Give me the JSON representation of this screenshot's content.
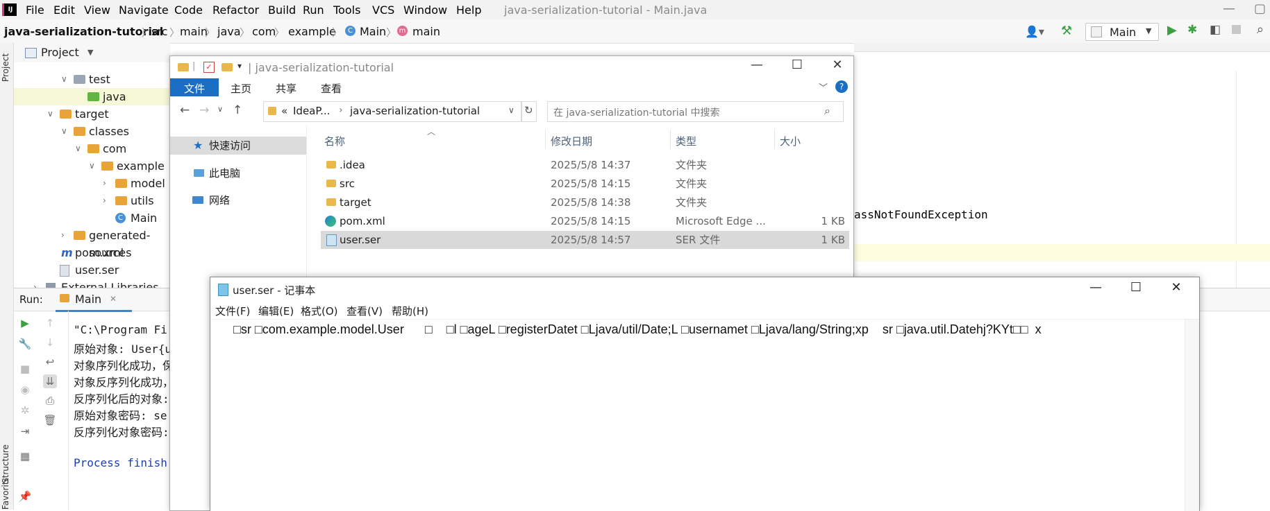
{
  "ide": {
    "logo": "IJ",
    "menu": [
      "File",
      "Edit",
      "View",
      "Navigate",
      "Code",
      "Refactor",
      "Build",
      "Run",
      "Tools",
      "VCS",
      "Window",
      "Help"
    ],
    "window_title": "java-serialization-tutorial - Main.java",
    "breadcrumb": [
      "java-serialization-tutorial",
      "src",
      "main",
      "java",
      "com",
      "example",
      "Main",
      "main"
    ],
    "run_config": "Main",
    "project_panel_title": "Project",
    "side_tabs": {
      "project": "Project",
      "structure": "Structure",
      "favorites": "Favorites"
    },
    "tree": [
      {
        "label": "test",
        "indent": 2,
        "kind": "folder-gray",
        "chevron": "down"
      },
      {
        "label": "java",
        "indent": 3,
        "kind": "folder-green",
        "chevron": "",
        "selected": true
      },
      {
        "label": "target",
        "indent": 1,
        "kind": "folder-orange",
        "chevron": "down"
      },
      {
        "label": "classes",
        "indent": 2,
        "kind": "folder-orange",
        "chevron": "down"
      },
      {
        "label": "com",
        "indent": 3,
        "kind": "folder-orange",
        "chevron": "down"
      },
      {
        "label": "example",
        "indent": 4,
        "kind": "folder-orange",
        "chevron": "down"
      },
      {
        "label": "model",
        "indent": 5,
        "kind": "folder-orange",
        "chevron": "right"
      },
      {
        "label": "utils",
        "indent": 5,
        "kind": "folder-orange",
        "chevron": "right"
      },
      {
        "label": "Main",
        "indent": 5,
        "kind": "class",
        "chevron": ""
      },
      {
        "label": "generated-sources",
        "indent": 2,
        "kind": "folder-orange",
        "chevron": "right"
      },
      {
        "label": "pom.xml",
        "indent": 1,
        "kind": "maven",
        "chevron": ""
      },
      {
        "label": "user.ser",
        "indent": 1,
        "kind": "file",
        "chevron": ""
      },
      {
        "label": "External Libraries",
        "indent": 0,
        "kind": "lib",
        "chevron": "right"
      }
    ],
    "editor_visible_text": "assNotFoundException",
    "run_label": "Run:",
    "run_tab": "Main",
    "console": [
      "\"C:\\Program Fi",
      "原始对象: User{u",
      "对象序列化成功，保",
      "对象反序列化成功，",
      "反序列化后的对象:",
      "原始对象密码: se",
      "反序列化对象密码:",
      "",
      "Process finish"
    ],
    "colors": {
      "accent": "#2f65ca",
      "run_green": "#3aa042",
      "folder_orange": "#e8a33a",
      "folder_green": "#62b543",
      "selection": "#d5e7fb"
    }
  },
  "explorer": {
    "title": "java-serialization-tutorial",
    "ribbon_tabs": [
      "文件",
      "主页",
      "共享",
      "查看"
    ],
    "address": [
      "IdeaP...",
      "java-serialization-tutorial"
    ],
    "address_prefix": "«",
    "search_placeholder": "在 java-serialization-tutorial 中搜索",
    "nav": [
      "快速访问",
      "此电脑",
      "网络"
    ],
    "columns": [
      "名称",
      "修改日期",
      "类型",
      "大小"
    ],
    "files": [
      {
        "name": ".idea",
        "date": "2025/5/8 14:37",
        "type": "文件夹",
        "size": "",
        "icon": "folder"
      },
      {
        "name": "src",
        "date": "2025/5/8 14:15",
        "type": "文件夹",
        "size": "",
        "icon": "folder"
      },
      {
        "name": "target",
        "date": "2025/5/8 14:38",
        "type": "文件夹",
        "size": "",
        "icon": "folder"
      },
      {
        "name": "pom.xml",
        "date": "2025/5/8 14:15",
        "type": "Microsoft Edge ...",
        "size": "1 KB",
        "icon": "edge"
      },
      {
        "name": "user.ser",
        "date": "2025/5/8 14:57",
        "type": "SER 文件",
        "size": "1 KB",
        "icon": "file",
        "selected": true
      }
    ]
  },
  "notepad": {
    "title": "user.ser - 记事本",
    "menu": [
      "文件(F)",
      "编辑(E)",
      "格式(O)",
      "查看(V)",
      "帮助(H)"
    ],
    "content": " □sr □com.example.model.User      □    □l □ageL □registerDatet □Ljava/util/Date;L □usernamet □Ljava/lang/String;xp    sr □java.util.Datehj?KYt□□  x"
  }
}
